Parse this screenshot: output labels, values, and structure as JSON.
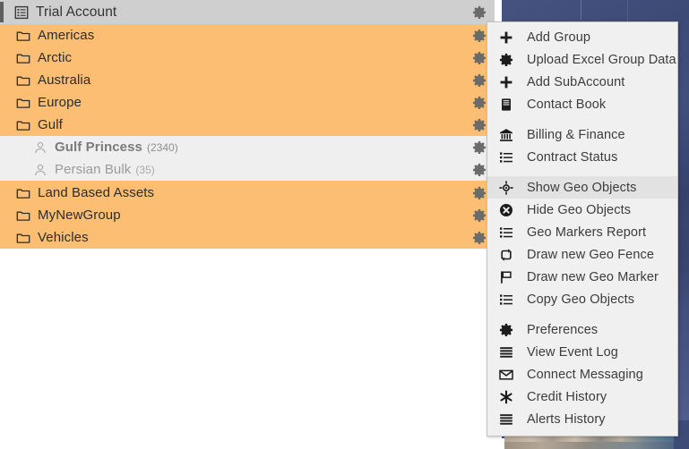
{
  "tree": {
    "account": {
      "label": "Trial Account",
      "icon": "list-box-icon",
      "gear_icon": "gear-icon"
    },
    "rows": [
      {
        "label": "Americas",
        "type": "group",
        "icon": "folder-icon",
        "count": ""
      },
      {
        "label": "Arctic",
        "type": "group",
        "icon": "folder-icon",
        "count": ""
      },
      {
        "label": "Australia",
        "type": "group",
        "icon": "folder-icon",
        "count": ""
      },
      {
        "label": "Europe",
        "type": "group",
        "icon": "folder-icon",
        "count": ""
      },
      {
        "label": "Gulf",
        "type": "group",
        "icon": "folder-icon",
        "count": ""
      },
      {
        "label": "Gulf Princess",
        "type": "asset-selected",
        "icon": "user-icon",
        "count": "(2340)"
      },
      {
        "label": "Persian Bulk",
        "type": "asset",
        "icon": "user-icon",
        "count": "(35)"
      },
      {
        "label": "Land Based Assets",
        "type": "group",
        "icon": "folder-icon",
        "count": ""
      },
      {
        "label": "MyNewGroup",
        "type": "group",
        "icon": "folder-icon",
        "count": ""
      },
      {
        "label": "Vehicles",
        "type": "group",
        "icon": "folder-icon",
        "count": ""
      }
    ]
  },
  "context_menu": {
    "items": [
      {
        "label": "Add Group",
        "icon": "plus-icon",
        "highlighted": false
      },
      {
        "label": "Upload Excel Group Data",
        "icon": "gear-icon",
        "highlighted": false
      },
      {
        "label": "Add SubAccount",
        "icon": "plus-icon",
        "highlighted": false
      },
      {
        "label": "Contact Book",
        "icon": "book-icon",
        "highlighted": false
      },
      {
        "separator": true
      },
      {
        "label": "Billing & Finance",
        "icon": "bank-icon",
        "highlighted": false
      },
      {
        "label": "Contract Status",
        "icon": "list-icon",
        "highlighted": false
      },
      {
        "separator": true
      },
      {
        "label": "Show Geo Objects",
        "icon": "crosshair-icon",
        "highlighted": true
      },
      {
        "label": "Hide Geo Objects",
        "icon": "close-circle-icon",
        "highlighted": false
      },
      {
        "label": "Geo Markers Report",
        "icon": "list-icon",
        "highlighted": false
      },
      {
        "label": "Draw new Geo Fence",
        "icon": "exchange-icon",
        "highlighted": false
      },
      {
        "label": "Draw new Geo Marker",
        "icon": "flag-icon",
        "highlighted": false
      },
      {
        "label": "Copy Geo Objects",
        "icon": "list-icon",
        "highlighted": false
      },
      {
        "separator": true
      },
      {
        "label": "Preferences",
        "icon": "gear-icon",
        "highlighted": false
      },
      {
        "label": "View Event Log",
        "icon": "lines-icon",
        "highlighted": false
      },
      {
        "label": "Connect Messaging",
        "icon": "envelope-icon",
        "highlighted": false
      },
      {
        "label": "Credit History",
        "icon": "asterisk-icon",
        "highlighted": false
      },
      {
        "label": "Alerts History",
        "icon": "lines-icon",
        "highlighted": false
      }
    ]
  },
  "colors": {
    "group_row": "#fcbe72",
    "account_row": "#cfcfcf",
    "asset_row": "#efefef",
    "menu_bg": "#f0f0f0",
    "menu_hover": "#e2e2e2",
    "background_sky": "#3d4a76"
  }
}
